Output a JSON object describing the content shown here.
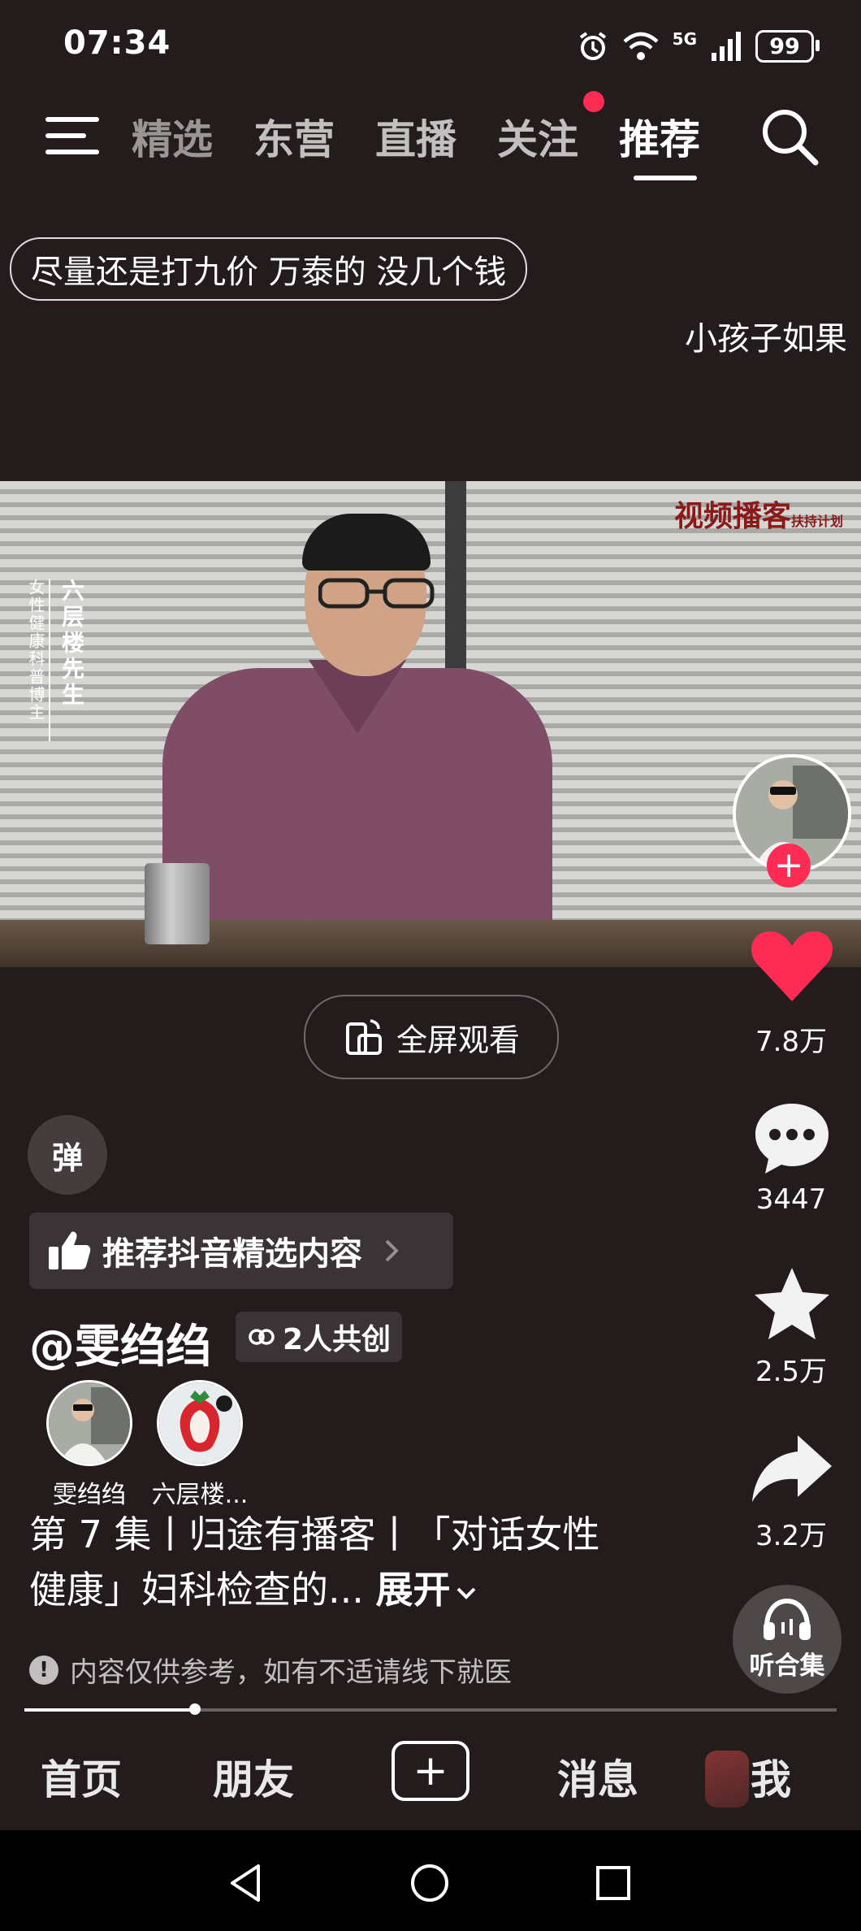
{
  "status_bar": {
    "time": "07:34",
    "network": "5G",
    "battery": "99"
  },
  "top_nav": {
    "tabs": [
      {
        "label": "精选",
        "active": false
      },
      {
        "label": "东营",
        "active": false
      },
      {
        "label": "直播",
        "active": false
      },
      {
        "label": "关注",
        "active": false,
        "has_dot": true
      },
      {
        "label": "推荐",
        "active": true
      }
    ]
  },
  "danmaku": [
    "尽量还是打九价 万泰的 没几个钱",
    "小孩子如果"
  ],
  "video": {
    "watermark": "视频播客",
    "watermark_small": "扶持计划",
    "overlay_title": "六层楼先生",
    "overlay_subtitle": "女性健康科普博主"
  },
  "fullscreen_button": {
    "label": "全屏观看"
  },
  "actions": {
    "like_count": "7.8万",
    "comment_count": "3447",
    "favorite_count": "2.5万",
    "share_count": "3.2万",
    "listen_label": "听合集"
  },
  "danmaku_toggle": "弹",
  "recommend_banner": "推荐抖音精选内容",
  "author": {
    "name": "@雯绉绉",
    "cocreate_label": "2人共创",
    "cocreators": [
      {
        "name": "雯绉绉"
      },
      {
        "name": "六层楼..."
      }
    ]
  },
  "description": {
    "text": "第 7 集丨归途有播客丨「对话女性健康」妇科检查的...",
    "expand_label": "展开"
  },
  "notice": "内容仅供参考，如有不适请线下就医",
  "progress": {
    "fraction": 0.21
  },
  "bottom_nav": {
    "home": "首页",
    "friends": "朋友",
    "messages": "消息",
    "me": "我"
  }
}
